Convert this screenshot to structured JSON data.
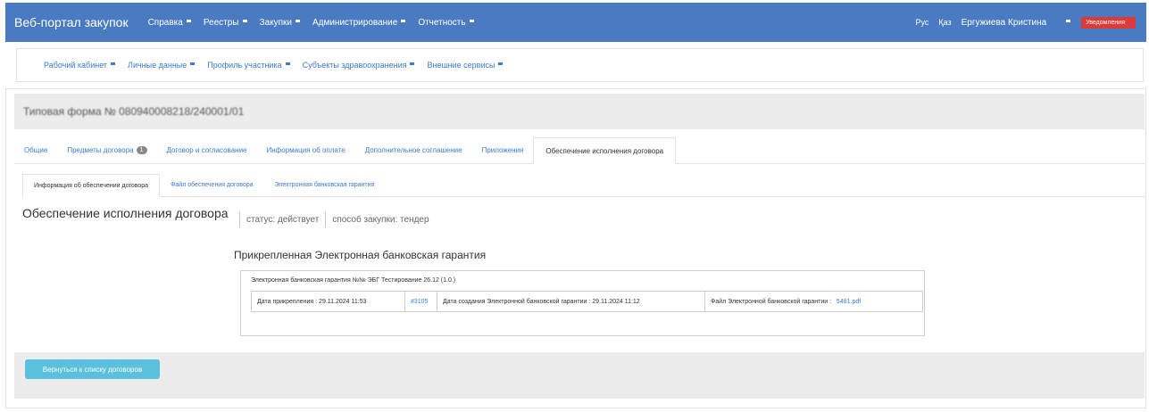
{
  "header": {
    "brand": "Веб-портал закупок",
    "menu": [
      "Справка",
      "Реестры",
      "Закупки",
      "Администрирование",
      "Отчетность"
    ],
    "lang_ru": "Рус",
    "lang_kz": "Қаз",
    "user": "Ергужиева Кристина",
    "notifications": "Уведомления",
    "notifications_color": "#dd3a3a",
    "accent": "#4a7ac2"
  },
  "subnav": {
    "items": [
      "Рабочий кабинет",
      "Личные данные",
      "Профиль участника",
      "Субъекты здравоохранения",
      "Внешние сервисы"
    ]
  },
  "form": {
    "title": "Типовая форма № 080940008218/240001/01"
  },
  "tabs": [
    {
      "label": "Общие"
    },
    {
      "label": "Предметы договора",
      "badge": "1"
    },
    {
      "label": "Договор и согласование"
    },
    {
      "label": "Информация об оплате"
    },
    {
      "label": "Дополнительное соглашение"
    },
    {
      "label": "Приложения"
    },
    {
      "label": "Обеспечение исполнения договора"
    }
  ],
  "subtabs": [
    "Информация об обеспечении договора",
    "Файл обеспечения договора",
    "Электронная банковская гарантия"
  ],
  "section": {
    "title": "Обеспечение исполнения договора",
    "status": "статус: действует",
    "method": "способ закупки: тендер"
  },
  "guarantee": {
    "heading": "Прикрепленная Электронная банковская гарантия",
    "title": "Электронная банковская гарантия №№ ЭБГ Тестирование 26.12 (1.0.)",
    "attach_date": "Дата прикрепления : 29.11.2024 11:53",
    "number": "#3105",
    "created": "Дата создания Электронной банковской гарантии : 29.11.2024 11:12",
    "file_label": "Файл Электронной банковской гарантии :",
    "file_name": "5481.pdf"
  },
  "footer": {
    "back_button": "Вернуться к списку договоров"
  }
}
